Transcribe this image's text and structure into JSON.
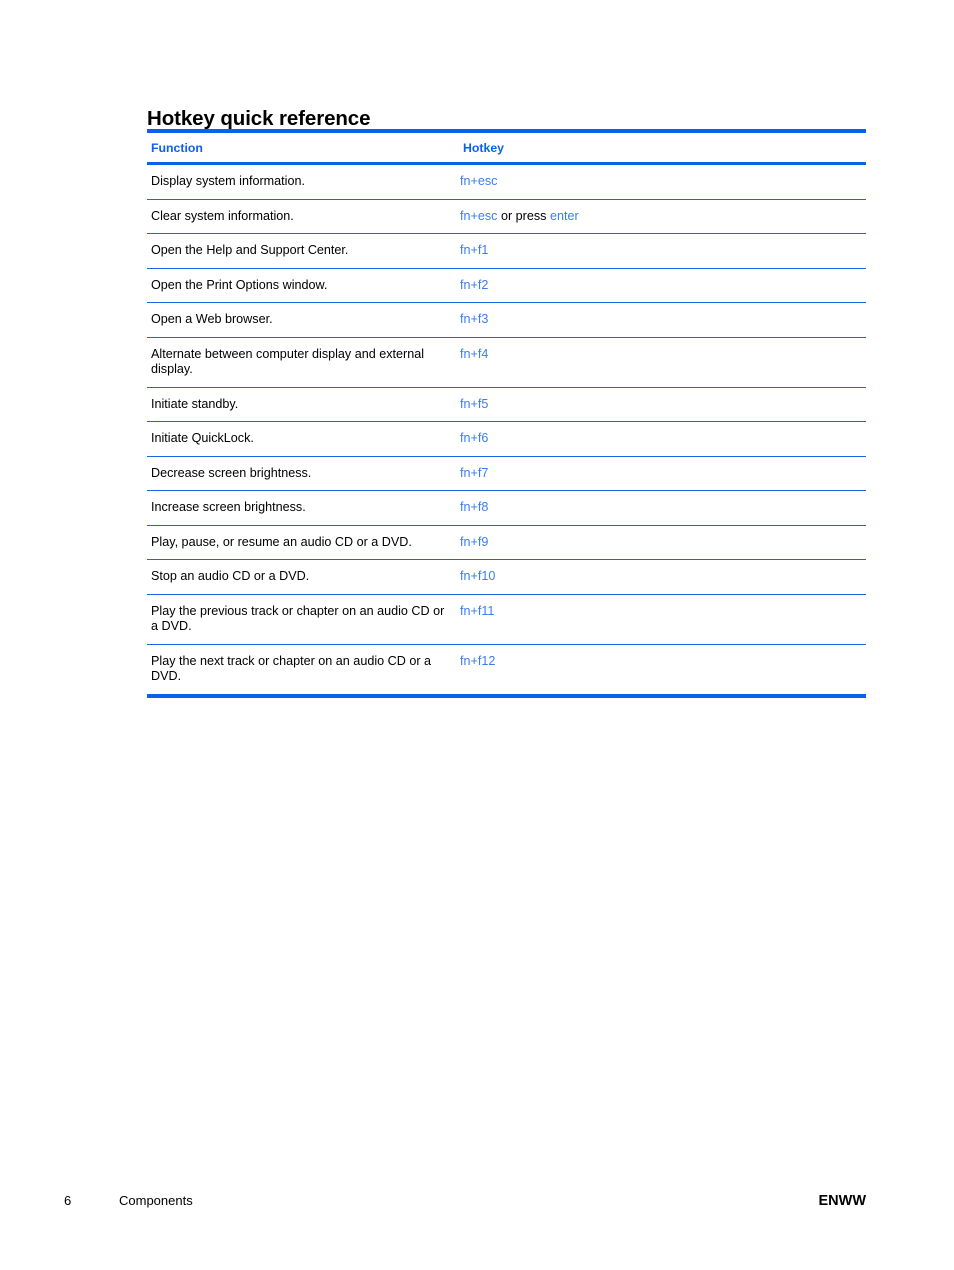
{
  "page": {
    "title": "Hotkey quick reference"
  },
  "table": {
    "columns": [
      {
        "key": "function",
        "label": "Function"
      },
      {
        "key": "hotkey",
        "label": "Hotkey"
      }
    ],
    "rows": [
      {
        "function": "Display system information.",
        "hotkey": "fn+esc",
        "hotkey_parts": [
          {
            "text": "fn+esc",
            "style": "key"
          }
        ]
      },
      {
        "function": "Clear system information.",
        "hotkey": "fn+esc or press enter",
        "hotkey_parts": [
          {
            "text": "fn+esc",
            "style": "key"
          },
          {
            "text": " or press ",
            "style": "plain"
          },
          {
            "text": "enter",
            "style": "key"
          }
        ]
      },
      {
        "function": "Open the Help and Support Center.",
        "hotkey": "fn+f1",
        "hotkey_parts": [
          {
            "text": "fn+f1",
            "style": "key"
          }
        ]
      },
      {
        "function": "Open the Print Options window.",
        "hotkey": "fn+f2",
        "hotkey_parts": [
          {
            "text": "fn+f2",
            "style": "key"
          }
        ]
      },
      {
        "function": "Open a Web browser.",
        "hotkey": "fn+f3",
        "hotkey_parts": [
          {
            "text": "fn+f3",
            "style": "key"
          }
        ]
      },
      {
        "function": "Alternate between computer display and external display.",
        "hotkey": "fn+f4",
        "hotkey_parts": [
          {
            "text": "fn+f4",
            "style": "key"
          }
        ]
      },
      {
        "function": "Initiate standby.",
        "hotkey": "fn+f5",
        "hotkey_parts": [
          {
            "text": "fn+f5",
            "style": "key"
          }
        ]
      },
      {
        "function": "Initiate QuickLock.",
        "hotkey": "fn+f6",
        "hotkey_parts": [
          {
            "text": "fn+f6",
            "style": "key"
          }
        ]
      },
      {
        "function": "Decrease screen brightness.",
        "hotkey": "fn+f7",
        "hotkey_parts": [
          {
            "text": "fn+f7",
            "style": "key"
          }
        ]
      },
      {
        "function": "Increase screen brightness.",
        "hotkey": "fn+f8",
        "hotkey_parts": [
          {
            "text": "fn+f8",
            "style": "key"
          }
        ]
      },
      {
        "function": "Play, pause, or resume an audio CD or a DVD.",
        "hotkey": "fn+f9",
        "hotkey_parts": [
          {
            "text": "fn+f9",
            "style": "key"
          }
        ]
      },
      {
        "function": "Stop an audio CD or a DVD.",
        "hotkey": "fn+f10",
        "hotkey_parts": [
          {
            "text": "fn+f10",
            "style": "key"
          }
        ]
      },
      {
        "function": "Play the previous track or chapter on an audio CD or a DVD.",
        "hotkey": "fn+f11",
        "hotkey_parts": [
          {
            "text": "fn+f11",
            "style": "key"
          }
        ]
      },
      {
        "function": "Play the next track or chapter on an audio CD or a DVD.",
        "hotkey": "fn+f12",
        "hotkey_parts": [
          {
            "text": "fn+f12",
            "style": "key"
          }
        ]
      }
    ]
  },
  "footer": {
    "page_number": "6",
    "chapter": "Components",
    "locale": "ENWW"
  },
  "colors": {
    "rule_blue": "#0b61ee",
    "header_text_blue": "#0b61ee",
    "hotkey_text_blue": "#3b7df0",
    "body_text": "#000000",
    "page_background": "#ffffff"
  }
}
